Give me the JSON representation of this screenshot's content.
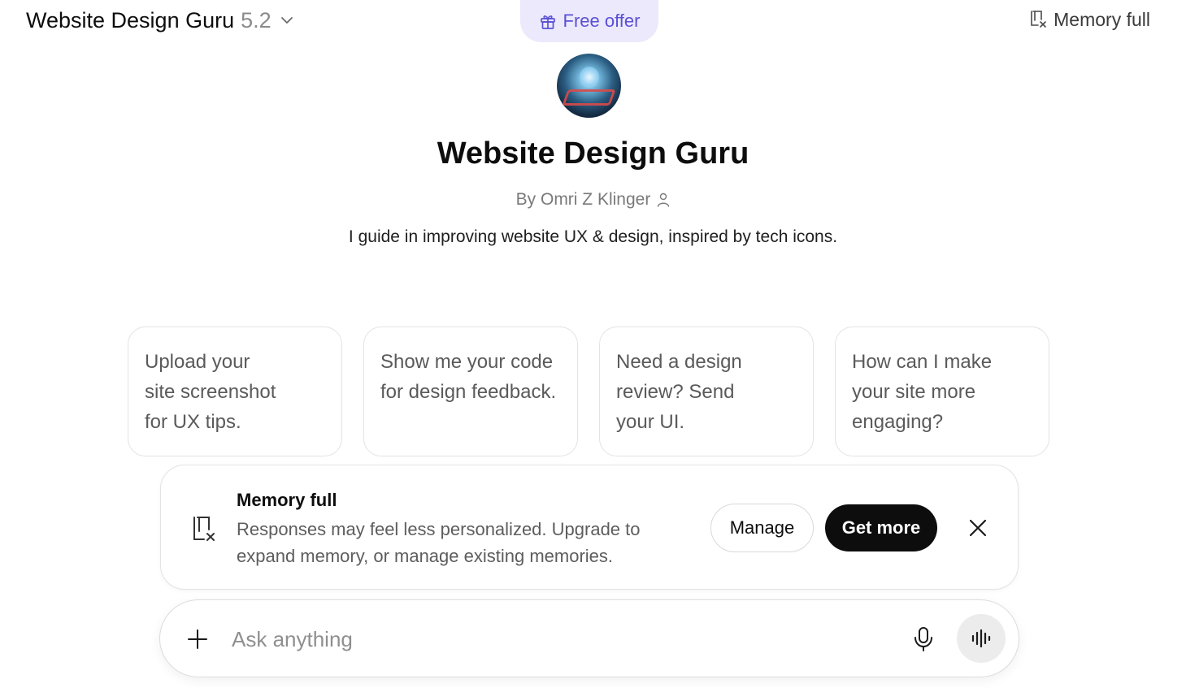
{
  "header": {
    "model_name": "Website Design Guru",
    "model_version": "5.2",
    "free_offer_label": "Free offer",
    "memory_status_label": "Memory full"
  },
  "gpt": {
    "title": "Website Design Guru",
    "author": "By Omri Z Klinger",
    "description": "I guide in improving website UX & design, inspired by tech icons."
  },
  "suggestions": [
    {
      "text": "Upload your site screenshot for UX tips."
    },
    {
      "text": "Show me your code for design feedback."
    },
    {
      "text": "Need a design review? Send your UI."
    },
    {
      "text": "How can I make your site more engaging?"
    }
  ],
  "memory_banner": {
    "title": "Memory full",
    "message": "Responses may feel less personalized. Upgrade to expand memory, or manage existing memories.",
    "manage_label": "Manage",
    "get_more_label": "Get more"
  },
  "composer": {
    "placeholder": "Ask anything"
  },
  "colors": {
    "accent": "#5b50d6",
    "free_offer_bg": "#ebe9fb",
    "primary_button": "#0d0d0d"
  }
}
